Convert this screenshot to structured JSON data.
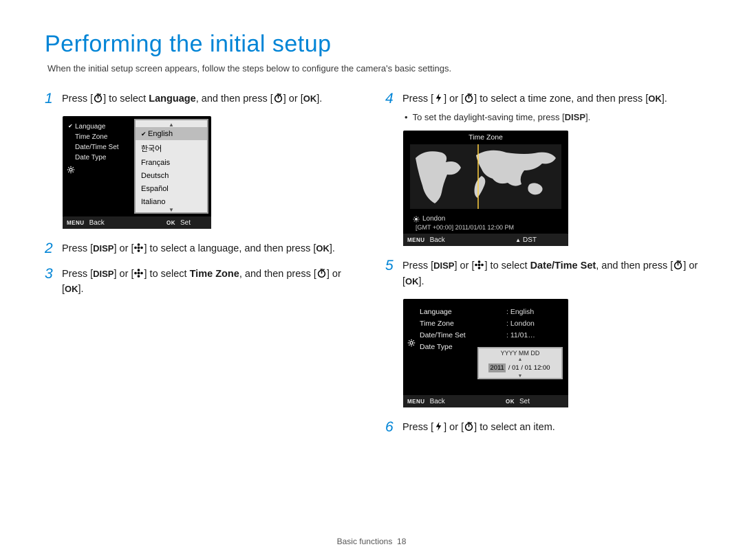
{
  "title": "Performing the initial setup",
  "subtitle": "When the initial setup screen appears, follow the steps below to configure the camera's basic settings.",
  "icons": {
    "timer": "timer-icon",
    "ok": "OK",
    "disp": "DISP",
    "flower": "flower-icon",
    "flash": "flash-icon",
    "menu": "MENU"
  },
  "steps": {
    "s1_a": "Press [",
    "s1_b": "] to select ",
    "s1_bold": "Language",
    "s1_c": ", and then press [",
    "s1_d": "] or [",
    "s1_e": "].",
    "s2_a": "Press [",
    "s2_b": "] or [",
    "s2_c": "] to select a language, and then press [",
    "s2_d": "].",
    "s3_a": "Press [",
    "s3_b": "] or [",
    "s3_c": "] to select ",
    "s3_bold": "Time Zone",
    "s3_d": ", and then press [",
    "s3_e": "] or [",
    "s3_f": "].",
    "s4_a": "Press [",
    "s4_b": "] or [",
    "s4_c": "] to select a time zone, and then press [",
    "s4_d": "].",
    "sub4": "To set the daylight-saving time, press [",
    "sub4_b": "].",
    "s5_a": "Press [",
    "s5_b": "] or [",
    "s5_c": "] to select ",
    "s5_bold": "Date/Time Set",
    "s5_d": ", and then press [",
    "s5_e": "] or [",
    "s5_f": "].",
    "s6_a": "Press [",
    "s6_b": "] or [",
    "s6_c": "] to select an item."
  },
  "lcd_lang": {
    "menu": [
      "Language",
      "Time Zone",
      "Date/Time Set",
      "Date Type"
    ],
    "opts": [
      "English",
      "한국어",
      "Français",
      "Deutsch",
      "Español",
      "Italiano"
    ],
    "back": "Back",
    "set": "Set"
  },
  "lcd_tz": {
    "title": "Time Zone",
    "city": "London",
    "gmt": "[GMT +00:00] 2011/01/01 12:00 PM",
    "back": "Back",
    "dst": "DST"
  },
  "lcd_dt": {
    "rows": [
      {
        "k": "Language",
        "v": ": English"
      },
      {
        "k": "Time Zone",
        "v": ": London"
      },
      {
        "k": "Date/Time Set",
        "v": ": 11/01…"
      },
      {
        "k": "Date Type",
        "v": ""
      }
    ],
    "fmt": "YYYY MM DD",
    "parts": [
      "2011",
      "/ 01 / 01 12:00"
    ],
    "back": "Back",
    "set": "Set"
  },
  "footer": {
    "section": "Basic functions",
    "page": "18"
  }
}
